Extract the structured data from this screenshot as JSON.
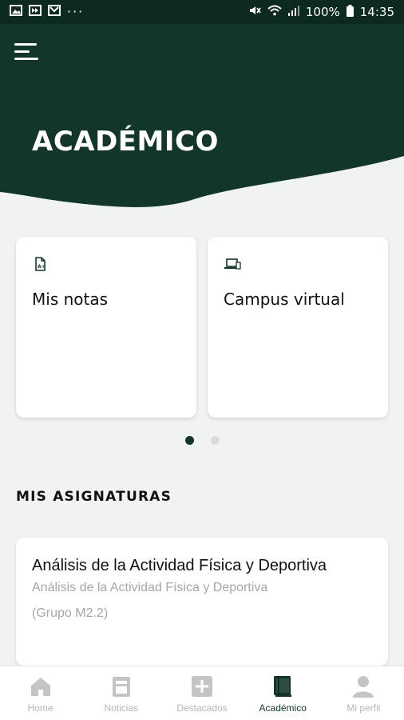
{
  "status_bar": {
    "battery": "100%",
    "time": "14:35",
    "more": "···"
  },
  "header": {
    "title": "ACADÉMICO",
    "menu_icon": "menu-icon"
  },
  "colors": {
    "primary": "#12362a",
    "header_bg": "#12362a",
    "background": "#f1f3f3",
    "muted_text": "#a6a6a6"
  },
  "shortcuts": [
    {
      "label": "Mis notas",
      "icon": "grades-document-icon"
    },
    {
      "label": "Campus virtual",
      "icon": "laptop-icon"
    }
  ],
  "carousel": {
    "pages": 2,
    "active": 0
  },
  "subjects_section": {
    "title": "MIS ASIGNATURAS",
    "items": [
      {
        "name": "Análisis de la Actividad Física y Deportiva",
        "subtitle": "Análisis de la Actividad Física y Deportiva",
        "group": "(Grupo M2.2)"
      }
    ]
  },
  "bottom_nav": [
    {
      "label": "Home",
      "icon": "home-icon",
      "active": false
    },
    {
      "label": "Noticias",
      "icon": "news-icon",
      "active": false
    },
    {
      "label": "Destacados",
      "icon": "plus-icon",
      "active": false
    },
    {
      "label": "Académico",
      "icon": "book-icon",
      "active": true
    },
    {
      "label": "Mi perfil",
      "icon": "user-icon",
      "active": false
    }
  ]
}
